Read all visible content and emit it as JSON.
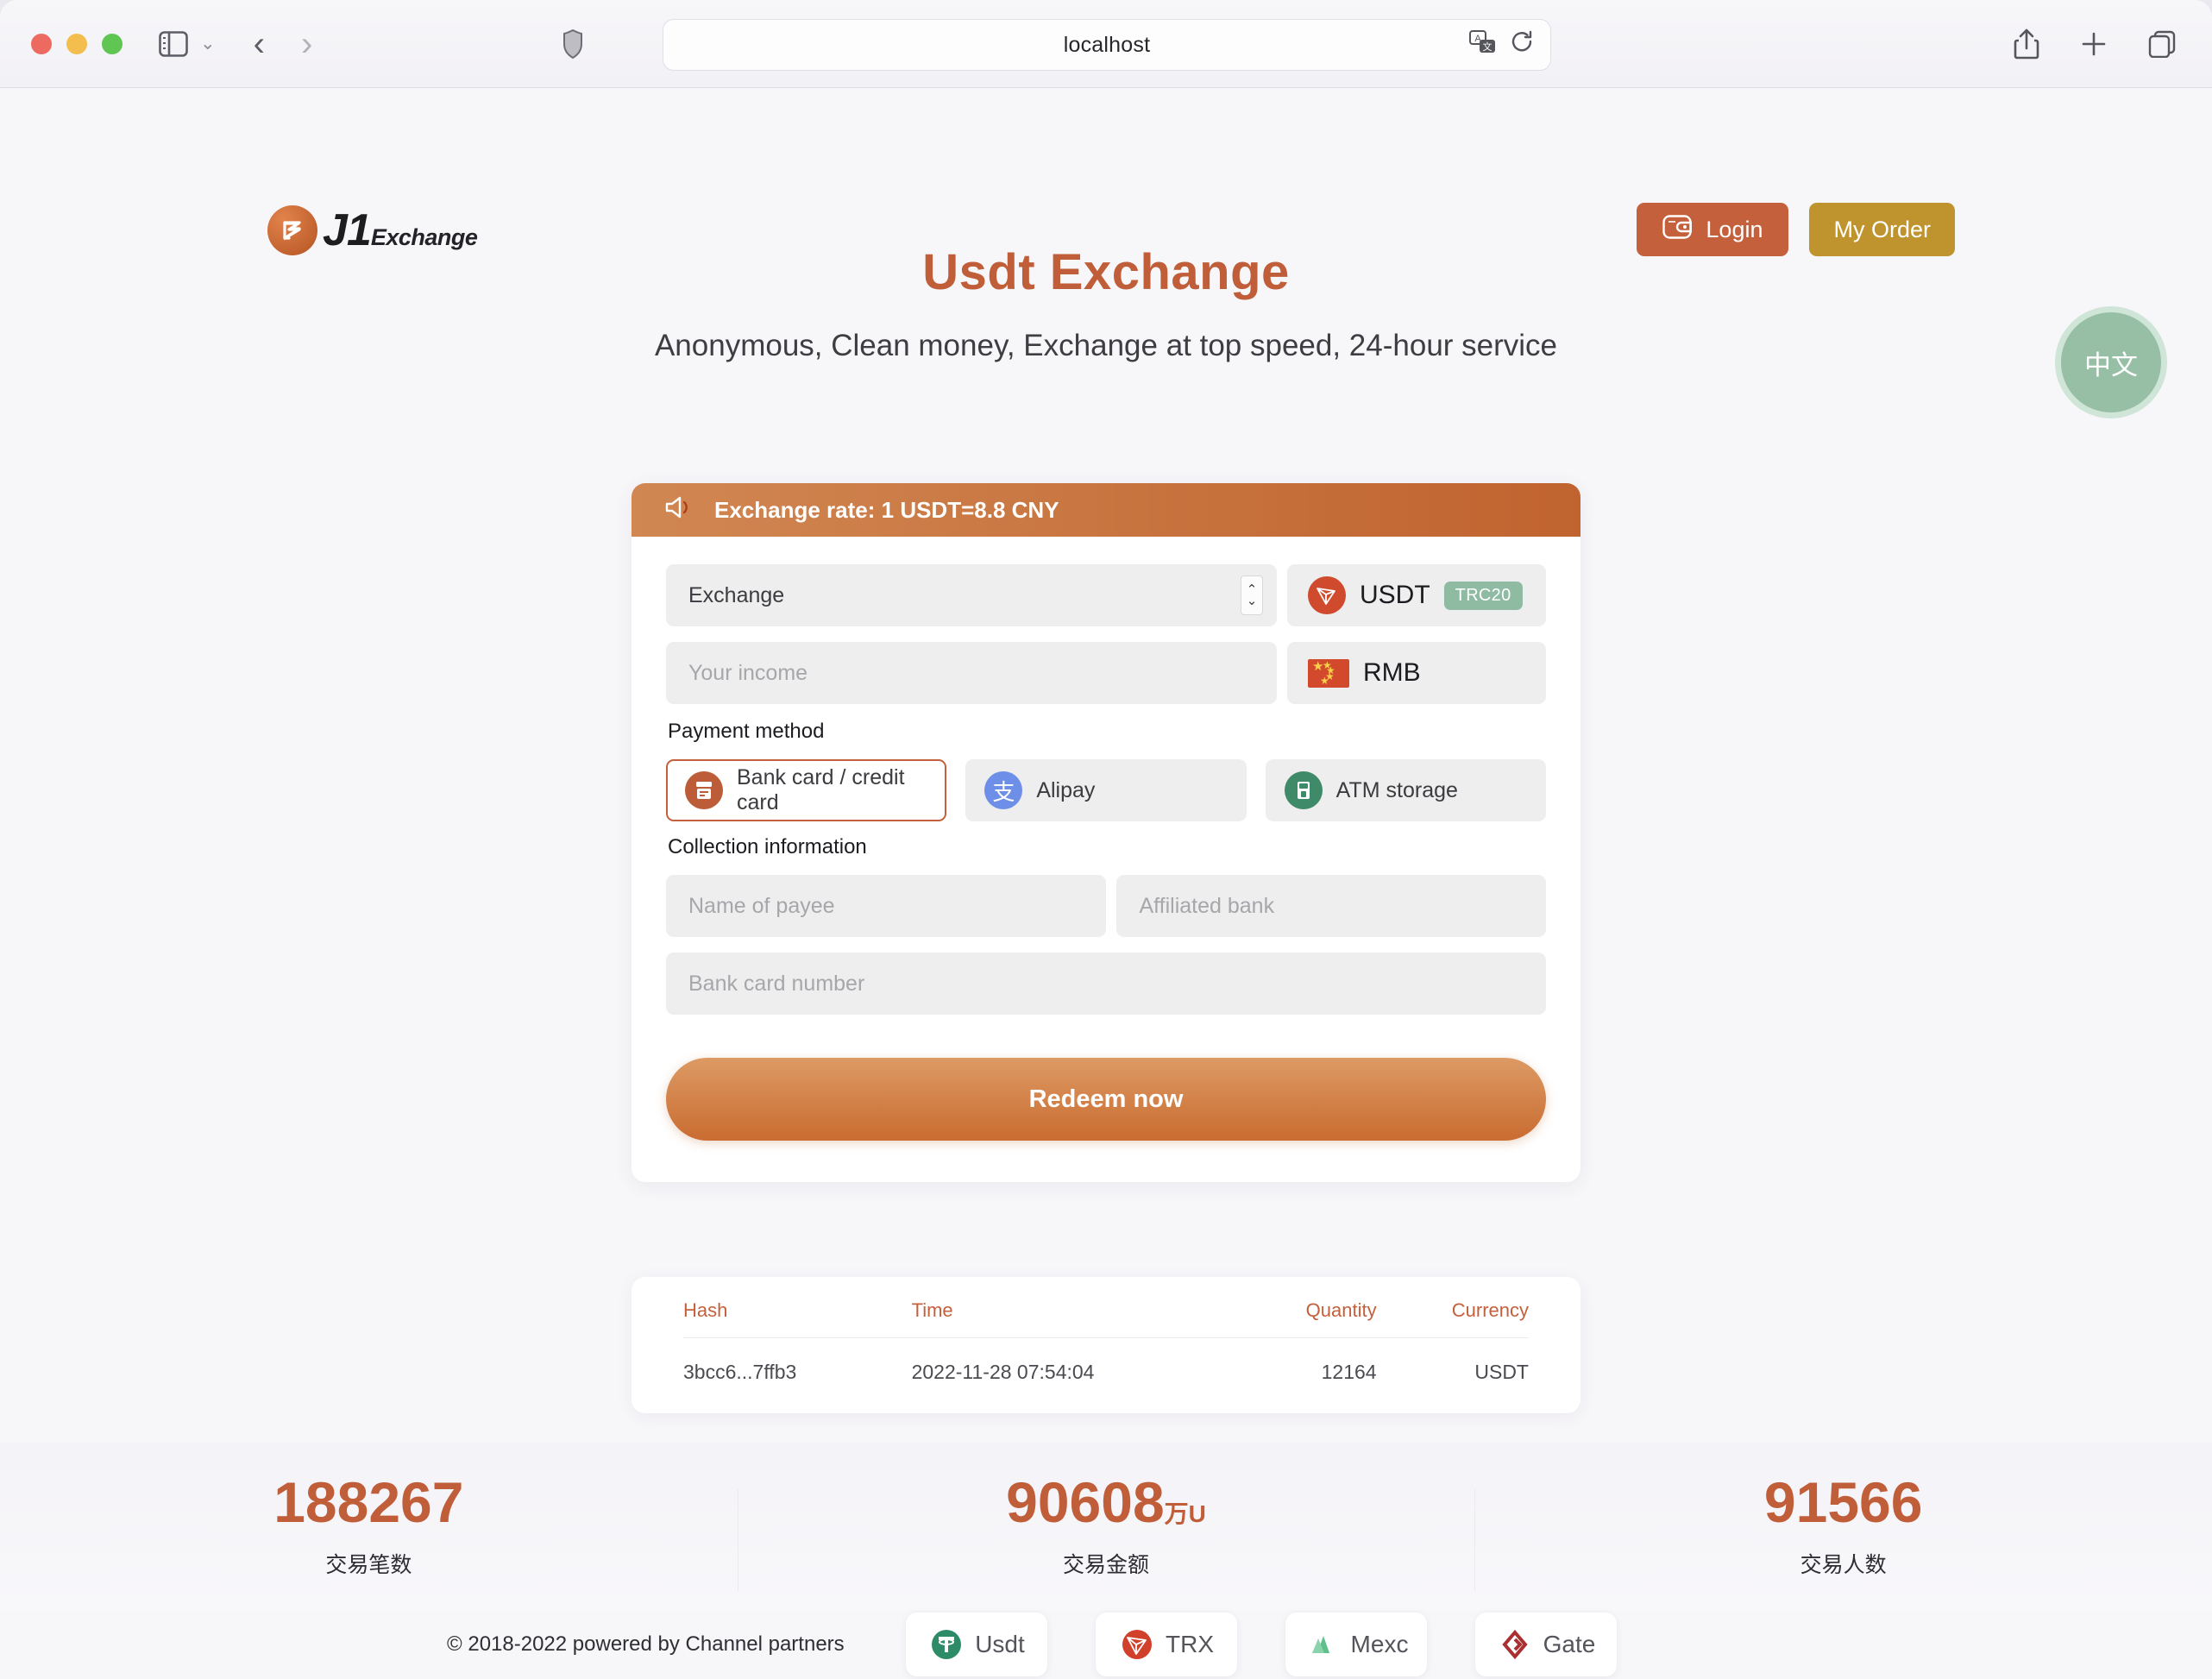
{
  "browser": {
    "url": "localhost",
    "icons": {
      "sidebar": "sidebar-icon",
      "sidebar_chevron": "chevron-down-icon",
      "back": "back-arrow-icon",
      "forward": "forward-arrow-icon",
      "shield": "privacy-shield-icon",
      "translate": "translate-icon",
      "reload": "reload-icon",
      "share": "share-icon",
      "new_tab": "plus-icon",
      "tabs": "tab-overview-icon"
    }
  },
  "header": {
    "logo_primary": "J1",
    "logo_secondary": "Exchange",
    "login_label": "Login",
    "my_order_label": "My Order",
    "lang_toggle_label": "中文"
  },
  "hero": {
    "title": "Usdt Exchange",
    "subtitle": "Anonymous, Clean money, Exchange at top speed, 24-hour service"
  },
  "exchange_card": {
    "rate_banner": "Exchange rate: 1 USDT=8.8 CNY",
    "amount_field": {
      "value": "Exchange",
      "placeholder": "Exchange"
    },
    "from_currency": {
      "name": "USDT",
      "network_badge": "TRC20"
    },
    "income_field": {
      "value": "",
      "placeholder": "Your income"
    },
    "to_currency": {
      "name": "RMB"
    },
    "payment_method_label": "Payment method",
    "payment_methods": [
      {
        "label": "Bank card / credit card",
        "icon": "bank-card-icon",
        "selected": true
      },
      {
        "label": "Alipay",
        "icon": "alipay-icon",
        "selected": false
      },
      {
        "label": "ATM storage",
        "icon": "atm-icon",
        "selected": false
      }
    ],
    "collection_label": "Collection information",
    "payee_field": {
      "value": "",
      "placeholder": "Name of payee"
    },
    "bank_field": {
      "value": "",
      "placeholder": "Affiliated bank"
    },
    "card_number_field": {
      "value": "",
      "placeholder": "Bank card number"
    },
    "submit_label": "Redeem now"
  },
  "transactions": {
    "columns": [
      "Hash",
      "Time",
      "Quantity",
      "Currency"
    ],
    "rows": [
      {
        "hash": "3bcc6...7ffb3",
        "time": "2022-11-28 07:54:04",
        "quantity": "12164",
        "currency": "USDT"
      }
    ]
  },
  "stats": [
    {
      "value": "188267",
      "unit": "",
      "label": "交易笔数"
    },
    {
      "value": "90608",
      "unit": "万U",
      "label": "交易金额"
    },
    {
      "value": "91566",
      "unit": "",
      "label": "交易人数"
    }
  ],
  "footer": {
    "copyright": "© 2018-2022 powered by Channel partners",
    "partners": [
      {
        "name": "Usdt",
        "icon": "tether-icon"
      },
      {
        "name": "TRX",
        "icon": "tron-icon"
      },
      {
        "name": "Mexc",
        "icon": "mexc-icon"
      },
      {
        "name": "Gate",
        "icon": "gate-icon"
      }
    ]
  },
  "colors": {
    "accent": "#c05e39",
    "gold": "#bf942f",
    "green_badge": "#8fbba2",
    "page_bg": "#f7f6f9"
  }
}
